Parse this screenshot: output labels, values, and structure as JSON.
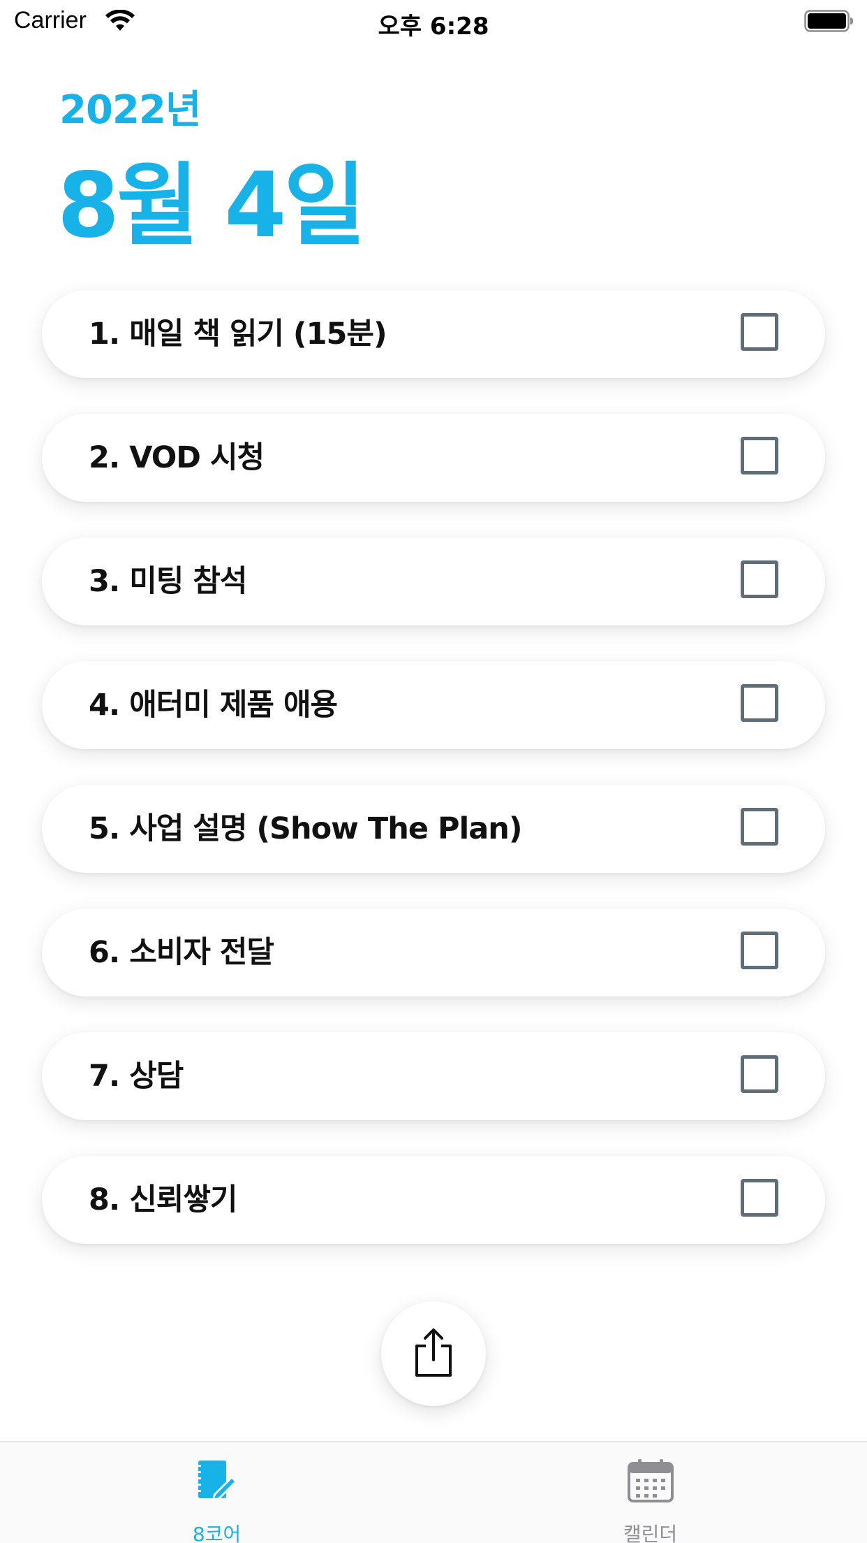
{
  "status_bar": {
    "carrier": "Carrier",
    "time": "오후 6:28"
  },
  "header": {
    "year": "2022년",
    "date": "8월 4일"
  },
  "tasks": [
    {
      "label": "1. 매일 책 읽기 (15분)",
      "checked": false
    },
    {
      "label": "2. VOD 시청",
      "checked": false
    },
    {
      "label": "3. 미팅 참석",
      "checked": false
    },
    {
      "label": "4. 애터미 제품 애용",
      "checked": false
    },
    {
      "label": "5. 사업 설명 (Show The Plan)",
      "checked": false
    },
    {
      "label": "6. 소비자 전달",
      "checked": false
    },
    {
      "label": "7. 상담",
      "checked": false
    },
    {
      "label": "8. 신뢰쌓기",
      "checked": false
    }
  ],
  "share": {
    "icon": "share-icon"
  },
  "tab_bar": {
    "tabs": [
      {
        "label": "8코어",
        "icon": "notebook-pencil-icon",
        "selected": true
      },
      {
        "label": "캘린더",
        "icon": "calendar-icon",
        "selected": false
      }
    ]
  },
  "colors": {
    "accent": "#17b3e8",
    "checkbox_border": "#5f6d79",
    "inactive_tab": "#8e8e93"
  }
}
